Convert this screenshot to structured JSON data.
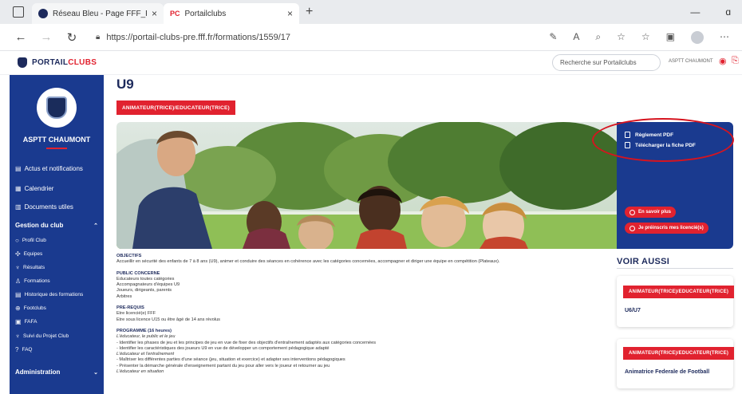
{
  "browser": {
    "tabs": [
      {
        "title": "Réseau Bleu - Page FFF_PRIVATE",
        "close": "×"
      },
      {
        "title": "Portailclubs",
        "close": "×",
        "favicon": "PC"
      }
    ],
    "new_tab": "+",
    "window_controls": [
      "—",
      "ɑ"
    ],
    "url": "https://portail-clubs-pre.fff.fr/formations/1559/17"
  },
  "header": {
    "logo_part1": "PORTAIL",
    "logo_part2": "CLUBS",
    "search_placeholder": "Recherche sur Portailclubs",
    "user_label": "ASPTT CHAUMONT"
  },
  "sidebar": {
    "club_name": "ASPTT CHAUMONT",
    "items": [
      {
        "label": "Actus et notifications",
        "icon": "news-icon"
      },
      {
        "label": "Calendrier",
        "icon": "calendar-icon"
      },
      {
        "label": "Documents utiles",
        "icon": "documents-icon"
      }
    ],
    "section_title": "Gestion du club",
    "sub_items": [
      {
        "label": "Profil Club",
        "icon": "profile-icon"
      },
      {
        "label": "Equipes",
        "icon": "teams-icon"
      },
      {
        "label": "Résultats",
        "icon": "trophy-icon"
      },
      {
        "label": "Formations",
        "icon": "person-icon"
      },
      {
        "label": "Historique des formations",
        "icon": "history-icon"
      },
      {
        "label": "Footclubs",
        "icon": "ball-icon"
      },
      {
        "label": "FAFA",
        "icon": "fafa-icon"
      },
      {
        "label": "Suivi du Projet Club",
        "icon": "trophy-icon"
      },
      {
        "label": "FAQ",
        "icon": "help-icon"
      }
    ],
    "footer_section": "Administration"
  },
  "main": {
    "title": "U9",
    "badge": "ANIMATEUR(TRICE)/EDUCATEUR(TRICE)",
    "panel": {
      "links": [
        "Règlement PDF",
        "Télécharger la fiche PDF"
      ],
      "buttons": [
        "En savoir plus",
        "Je préinscris mes licencié(s)"
      ]
    },
    "sections": [
      {
        "heading": "OBJECTIFS",
        "lines": [
          "Accueillir en sécurité des enfants de 7 à 8 ans (U9), animer et conduire des séances en cohérence avec les catégories concernées, accompagner et diriger une équipe en compétition (Plateaux)."
        ]
      },
      {
        "heading": "PUBLIC CONCERNE",
        "lines": [
          "Educateurs toutes catégories",
          "Accompagnateurs d'équipes U9",
          "Joueurs, dirigeants, parents",
          "Arbitres"
        ]
      },
      {
        "heading": "PRE-REQUIS",
        "lines": [
          "Etre licencié(e) FFF",
          "Etre sous licence U15 ou être âgé de 14 ans révolus"
        ]
      },
      {
        "heading": "PROGRAMME (16 heures)",
        "lines": [
          "L'éducateur, le public et le jeu",
          "- Identifier les phases de jeu et les principes de jeu en vue de fixer des objectifs d'entraînement adaptés aux catégories concernées",
          "- Identifier les caractéristiques des joueurs U9 en vue de développer un comportement pédagogique adapté",
          "L'éducateur et l'entraînement",
          "- Maîtriser les différentes parties d'une séance (jeu, situation et exercice) et adapter ses interventions pédagogiques",
          "- Présenter la démarche générale d'enseignement partant du jeu pour aller vers le joueur et retourner au jeu",
          "L'éducateur en situation"
        ]
      }
    ],
    "voir_aussi": {
      "title": "VOIR AUSSI",
      "cards": [
        {
          "badge": "ANIMATEUR(TRICE)/EDUCATEUR(TRICE)",
          "title": "U6/U7"
        },
        {
          "badge": "ANIMATEUR(TRICE)/EDUCATEUR(TRICE)",
          "title": "Animatrice Federale de Football"
        }
      ]
    }
  },
  "colors": {
    "brand_blue": "#1a3a8f",
    "accent_red": "#e1222f",
    "annotation_red": "#d6141f"
  }
}
